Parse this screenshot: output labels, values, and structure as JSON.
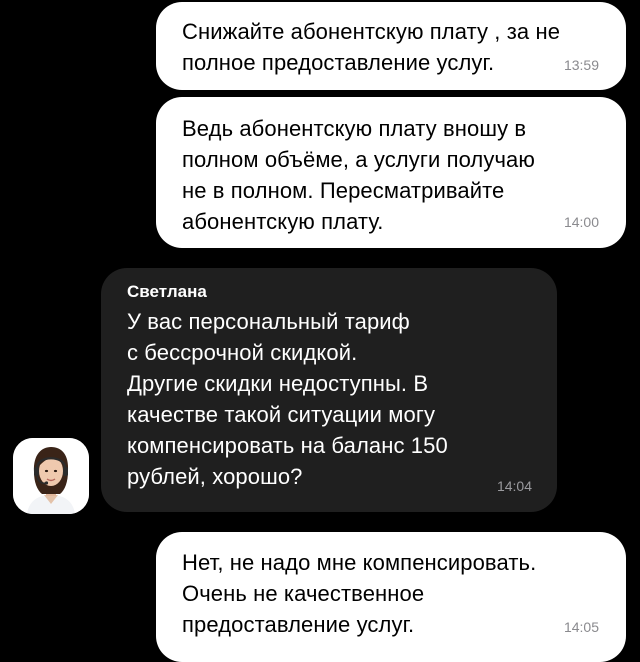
{
  "messages": [
    {
      "direction": "outgoing",
      "text": "Снижайте абонентскую плату , за не\nполное предоставление услуг.",
      "time": "13:59"
    },
    {
      "direction": "outgoing",
      "text": "Ведь абонентскую плату вношу в\nполном объёме, а услуги получаю\nне в полном. Пересматривайте\nабонентскую плату.",
      "time": "14:00"
    },
    {
      "direction": "incoming",
      "sender": "Светлана",
      "text": "У вас персональный тариф\nс бессрочной скидкой.\nДругие скидки недоступны. В\nкачестве такой ситуации могу\nкомпенсировать на баланс 150\nрублей, хорошо?",
      "time": "14:04"
    },
    {
      "direction": "outgoing",
      "text": "Нет, не надо мне компенсировать.\nОчень не качественное\nпредоставление услуг.",
      "time": "14:05"
    }
  ],
  "agent": {
    "avatar_icon": "support-agent-avatar-icon"
  },
  "colors": {
    "background": "#000000",
    "outgoing_bubble": "#ffffff",
    "incoming_bubble": "#1f1f1f",
    "timestamp": "#8a8a8e"
  }
}
